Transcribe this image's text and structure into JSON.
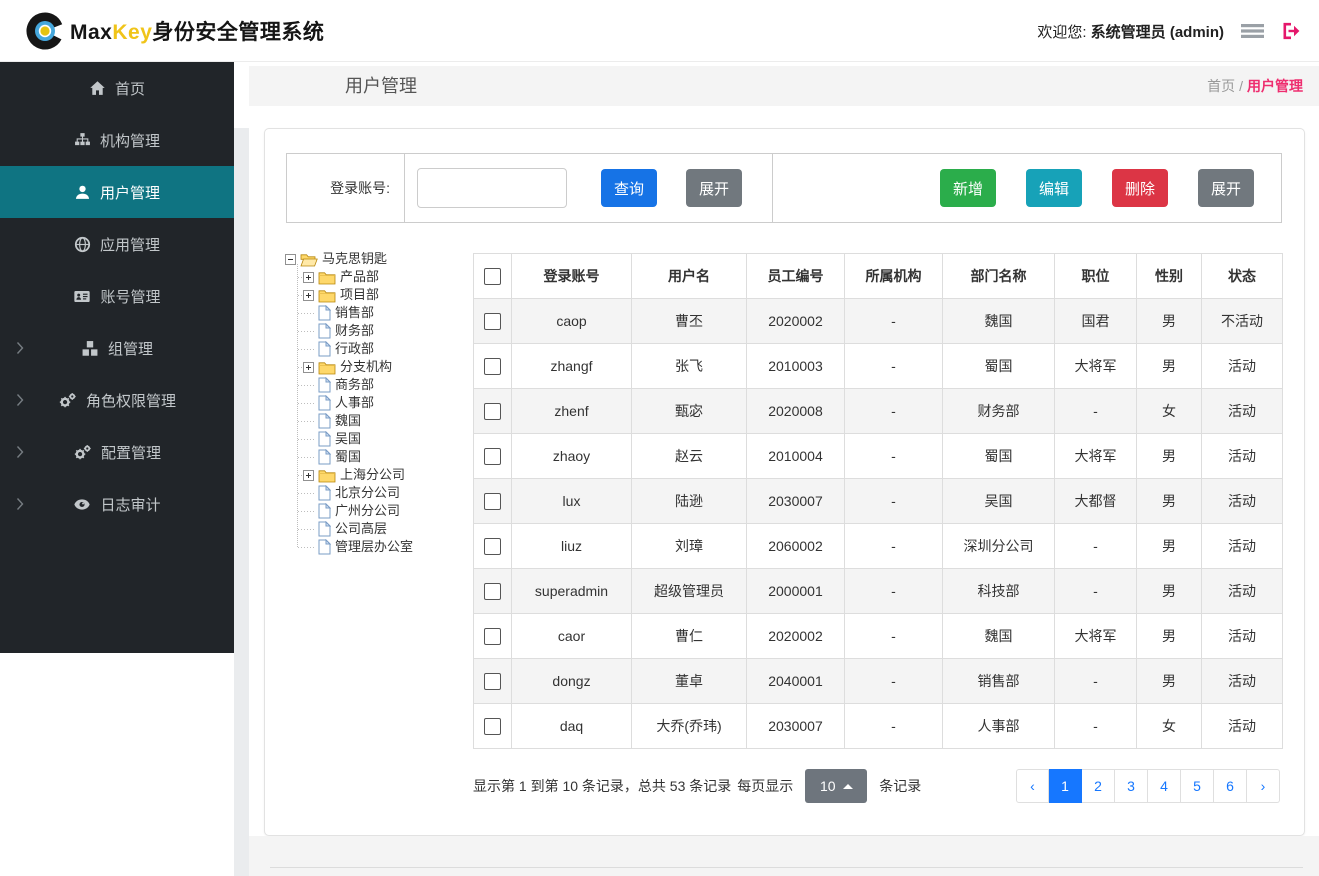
{
  "navbar": {
    "brand_max": "Max",
    "brand_key": "Key",
    "brand_suffix": "身份安全管理系统",
    "welcome_prefix": "欢迎您:",
    "welcome_user": "系统管理员 (admin)"
  },
  "sidebar": {
    "items": [
      {
        "key": "home",
        "label": "首页",
        "icon": "home-icon",
        "active": false,
        "expandable": false
      },
      {
        "key": "org",
        "label": "机构管理",
        "icon": "sitemap-icon",
        "active": false,
        "expandable": false
      },
      {
        "key": "user",
        "label": "用户管理",
        "icon": "user-icon",
        "active": true,
        "expandable": false
      },
      {
        "key": "app",
        "label": "应用管理",
        "icon": "globe-icon",
        "active": false,
        "expandable": false
      },
      {
        "key": "account",
        "label": "账号管理",
        "icon": "id-card-icon",
        "active": false,
        "expandable": false
      },
      {
        "key": "group",
        "label": "组管理",
        "icon": "cubes-icon",
        "active": false,
        "expandable": true
      },
      {
        "key": "role",
        "label": "角色权限管理",
        "icon": "gears-icon",
        "active": false,
        "expandable": true
      },
      {
        "key": "config",
        "label": "配置管理",
        "icon": "gears-icon",
        "active": false,
        "expandable": true
      },
      {
        "key": "audit",
        "label": "日志审计",
        "icon": "eye-icon",
        "active": false,
        "expandable": true
      }
    ]
  },
  "page": {
    "title": "用户管理",
    "breadcrumb": {
      "home": "首页",
      "separator": "/",
      "current": "用户管理"
    }
  },
  "search": {
    "label": "登录账号:",
    "input_value": "",
    "query_button": "查询",
    "expand_button": "展开"
  },
  "toolbar": {
    "add_button": "新增",
    "edit_button": "编辑",
    "delete_button": "删除",
    "expand_button": "展开"
  },
  "tree": {
    "nodes": [
      {
        "label": "马克思钥匙",
        "type": "root",
        "icon": "folder-open-icon",
        "expander": "minus"
      },
      {
        "label": "产品部",
        "type": "folder",
        "icon": "folder-icon",
        "expander": "plus"
      },
      {
        "label": "项目部",
        "type": "folder",
        "icon": "folder-icon",
        "expander": "plus"
      },
      {
        "label": "销售部",
        "type": "leaf",
        "icon": "file-icon"
      },
      {
        "label": "财务部",
        "type": "leaf",
        "icon": "file-icon"
      },
      {
        "label": "行政部",
        "type": "leaf",
        "icon": "file-icon"
      },
      {
        "label": "分支机构",
        "type": "folder",
        "icon": "folder-icon",
        "expander": "plus"
      },
      {
        "label": "商务部",
        "type": "leaf",
        "icon": "file-icon"
      },
      {
        "label": "人事部",
        "type": "leaf",
        "icon": "file-icon"
      },
      {
        "label": "魏国",
        "type": "leaf",
        "icon": "file-icon"
      },
      {
        "label": "吴国",
        "type": "leaf",
        "icon": "file-icon"
      },
      {
        "label": "蜀国",
        "type": "leaf",
        "icon": "file-icon"
      },
      {
        "label": "上海分公司",
        "type": "folder",
        "icon": "folder-icon",
        "expander": "plus"
      },
      {
        "label": "北京分公司",
        "type": "leaf",
        "icon": "file-icon"
      },
      {
        "label": "广州分公司",
        "type": "leaf",
        "icon": "file-icon"
      },
      {
        "label": "公司高层",
        "type": "leaf",
        "icon": "file-icon"
      },
      {
        "label": "管理层办公室",
        "type": "leaf",
        "icon": "file-icon"
      }
    ]
  },
  "table": {
    "columns": [
      "登录账号",
      "用户名",
      "员工编号",
      "所属机构",
      "部门名称",
      "职位",
      "性别",
      "状态"
    ],
    "rows": [
      [
        "caop",
        "曹丕",
        "2020002",
        "-",
        "魏国",
        "国君",
        "男",
        "不活动"
      ],
      [
        "zhangf",
        "张飞",
        "2010003",
        "-",
        "蜀国",
        "大将军",
        "男",
        "活动"
      ],
      [
        "zhenf",
        "甄宓",
        "2020008",
        "-",
        "财务部",
        "-",
        "女",
        "活动"
      ],
      [
        "zhaoy",
        "赵云",
        "2010004",
        "-",
        "蜀国",
        "大将军",
        "男",
        "活动"
      ],
      [
        "lux",
        "陆逊",
        "2030007",
        "-",
        "吴国",
        "大都督",
        "男",
        "活动"
      ],
      [
        "liuz",
        "刘璋",
        "2060002",
        "-",
        "深圳分公司",
        "-",
        "男",
        "活动"
      ],
      [
        "superadmin",
        "超级管理员",
        "2000001",
        "-",
        "科技部",
        "-",
        "男",
        "活动"
      ],
      [
        "caor",
        "曹仁",
        "2020002",
        "-",
        "魏国",
        "大将军",
        "男",
        "活动"
      ],
      [
        "dongz",
        "董卓",
        "2040001",
        "-",
        "销售部",
        "-",
        "男",
        "活动"
      ],
      [
        "daq",
        "大乔(乔玮)",
        "2030007",
        "-",
        "人事部",
        "-",
        "女",
        "活动"
      ]
    ]
  },
  "pagination": {
    "info": "显示第 1 到第 10 条记录，总共 53 条记录",
    "per_page_prefix": "每页显示",
    "per_page_value": "10",
    "per_page_suffix": "条记录",
    "prev": "‹",
    "next": "›",
    "pages": [
      "1",
      "2",
      "3",
      "4",
      "5",
      "6"
    ],
    "active_page": "1"
  },
  "colors": {
    "sidebar_bg": "#212529",
    "active_teal": "#0f7482",
    "query_blue": "#1673e6",
    "add_green": "#2bad4b",
    "edit_teal": "#17a2b8",
    "delete_red": "#dc3545",
    "gray_button": "#71787e",
    "breadcrumb_pink": "#ee2d6f",
    "brand_yellow": "#f0c419",
    "page_link_blue": "#1677ff"
  }
}
